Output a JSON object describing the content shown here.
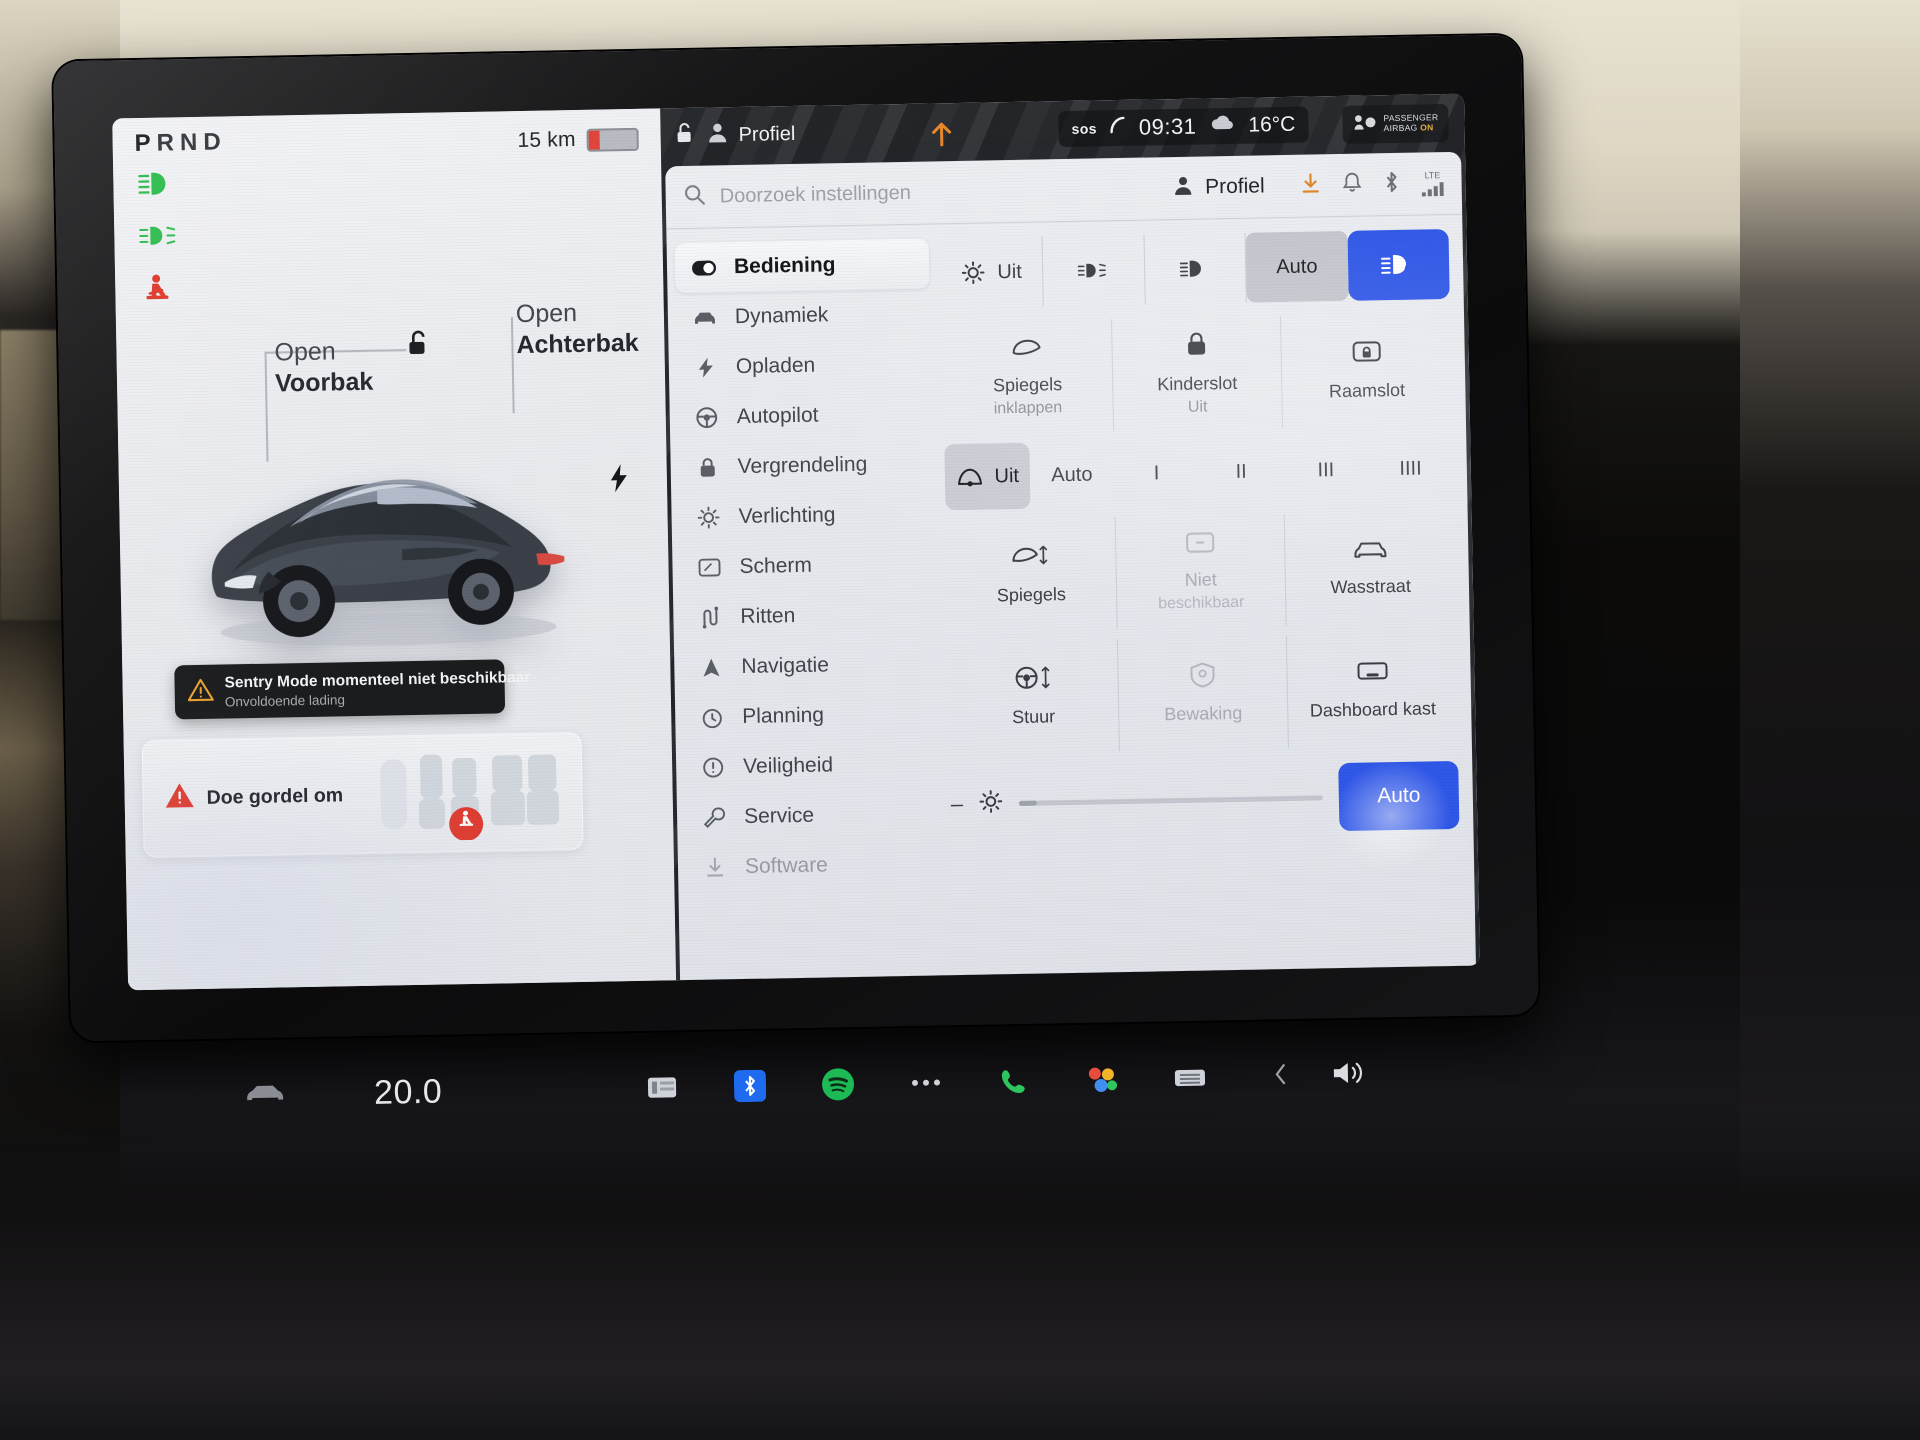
{
  "vehicle": {
    "gear_indicator": "PRND",
    "active_gear": "P",
    "range_value": "15 km",
    "battery_level_percent": 22,
    "telltales": [
      {
        "name": "low-beam-headlight-telltale",
        "color": "#2fbd4e"
      },
      {
        "name": "front-fog-light-telltale",
        "color": "#2fbd4e"
      },
      {
        "name": "seatbelt-warning-telltale",
        "color": "#e0392c"
      }
    ],
    "frunk": {
      "action": "Open",
      "label": "Voorbak"
    },
    "trunk": {
      "action": "Open",
      "label": "Achterbak"
    },
    "sentry_toast": {
      "title": "Sentry Mode momenteel niet beschikbaar",
      "subtitle": "Onvoldoende lading"
    },
    "seatbelt_card": {
      "label": "Doe gordel om"
    }
  },
  "statusbar": {
    "profile_label": "Profiel",
    "sos_label": "sos",
    "time": "09:31",
    "temperature": "16°C",
    "airbag": {
      "line1": "PASSENGER",
      "line2": "AIRBAG",
      "state": "ON"
    }
  },
  "settings": {
    "search_placeholder": "Doorzoek instellingen",
    "profile_button": "Profiel",
    "tray_icons": [
      "download-icon",
      "bell-icon",
      "bluetooth-icon",
      "lte-signal-icon"
    ],
    "lte_label": "LTE",
    "sidebar": [
      {
        "label": "Bediening",
        "icon": "toggle-switch-icon",
        "active": true
      },
      {
        "label": "Dynamiek",
        "icon": "car-front-icon",
        "active": false
      },
      {
        "label": "Opladen",
        "icon": "lightning-bolt-icon",
        "active": false
      },
      {
        "label": "Autopilot",
        "icon": "steering-wheel-icon",
        "active": false
      },
      {
        "label": "Vergrendeling",
        "icon": "lock-icon",
        "active": false
      },
      {
        "label": "Verlichting",
        "icon": "sun-brightness-icon",
        "active": false
      },
      {
        "label": "Scherm",
        "icon": "display-icon",
        "active": false
      },
      {
        "label": "Ritten",
        "icon": "trip-route-icon",
        "active": false
      },
      {
        "label": "Navigatie",
        "icon": "navigation-arrow-icon",
        "active": false
      },
      {
        "label": "Planning",
        "icon": "clock-schedule-icon",
        "active": false
      },
      {
        "label": "Veiligheid",
        "icon": "exclamation-circle-icon",
        "active": false
      },
      {
        "label": "Service",
        "icon": "wrench-icon",
        "active": false
      },
      {
        "label": "Software",
        "icon": "download-arrow-icon",
        "active": false
      }
    ],
    "lights_row": [
      {
        "label": "Uit",
        "icon": "interior-light-icon",
        "state": "normal"
      },
      {
        "label": "",
        "icon": "fog-light-icon",
        "state": "normal"
      },
      {
        "label": "",
        "icon": "low-beam-icon",
        "state": "normal"
      },
      {
        "label": "Auto",
        "icon": "",
        "state": "selected"
      },
      {
        "label": "",
        "icon": "auto-headlight-icon",
        "state": "highlighted"
      }
    ],
    "controls_row_1": [
      {
        "label": "Spiegels",
        "sublabel": "inklappen",
        "icon": "mirror-fold-icon",
        "state": "normal"
      },
      {
        "label": "Kinderslot",
        "sublabel": "Uit",
        "icon": "child-lock-icon",
        "state": "normal"
      },
      {
        "label": "Raamslot",
        "sublabel": "",
        "icon": "window-lock-icon",
        "state": "normal"
      }
    ],
    "wiper_row": [
      {
        "label": "Uit",
        "icon": "wiper-icon",
        "state": "selected"
      },
      {
        "label": "Auto",
        "icon": "",
        "state": "normal"
      },
      {
        "label": "I",
        "icon": "",
        "state": "normal"
      },
      {
        "label": "II",
        "icon": "",
        "state": "normal"
      },
      {
        "label": "III",
        "icon": "",
        "state": "normal"
      },
      {
        "label": "IIII",
        "icon": "",
        "state": "normal"
      }
    ],
    "controls_row_2": [
      {
        "label": "Spiegels",
        "sublabel": "",
        "icon": "mirror-adjust-icon",
        "state": "normal"
      },
      {
        "label": "Niet",
        "sublabel": "beschikbaar",
        "icon": "unavailable-icon",
        "state": "disabled"
      },
      {
        "label": "Wasstraat",
        "sublabel": "",
        "icon": "car-wash-icon",
        "state": "normal"
      }
    ],
    "controls_row_3": [
      {
        "label": "Stuur",
        "sublabel": "",
        "icon": "steering-adjust-icon",
        "state": "normal"
      },
      {
        "label": "Bewaking",
        "sublabel": "",
        "icon": "sentry-camera-icon",
        "state": "disabled"
      },
      {
        "label": "Dashboard kast",
        "sublabel": "",
        "icon": "glovebox-icon",
        "state": "normal"
      }
    ],
    "brightness": {
      "minus": "–",
      "icon": "brightness-icon",
      "value_percent": 6,
      "auto_label": "Auto"
    }
  },
  "dock": {
    "car_icon": "car-side-icon",
    "temperature": "20.0",
    "apps": [
      "climate-icon",
      "bluetooth-icon",
      "spotify-icon",
      "more-dots-icon",
      "phone-icon",
      "media-apps-icon",
      "rear-defrost-icon"
    ],
    "volume_icon": "volume-icon",
    "chevron_left": "chevron-left-icon"
  },
  "colors": {
    "accent_blue": "#2f57e8",
    "warning_red": "#e0392c",
    "telltale_green": "#2fbd4e",
    "airbag_amber": "#e8b33a",
    "spotify_green": "#1db954",
    "screen_bg": "#e9eaee"
  }
}
